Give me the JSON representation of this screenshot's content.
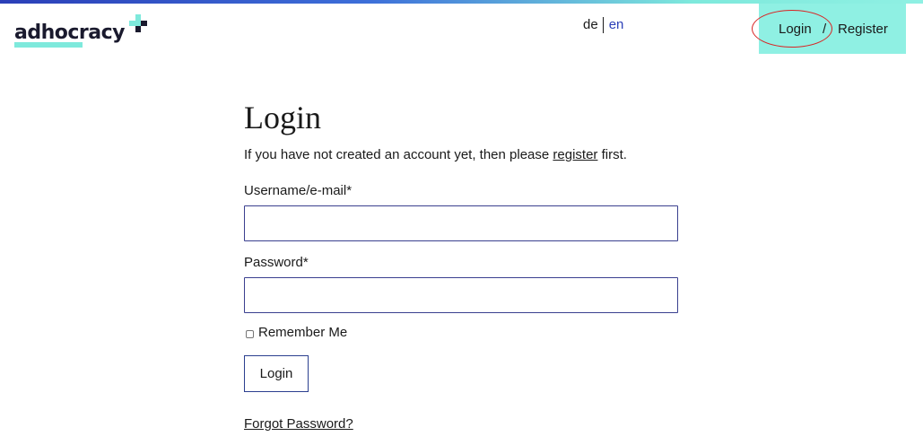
{
  "header": {
    "logo_text": "adhocracy",
    "languages": {
      "de": "de",
      "en": "en",
      "active": "en"
    },
    "auth": {
      "login_label": "Login",
      "separator": "/",
      "register_label": "Register"
    }
  },
  "main": {
    "title": "Login",
    "intro_before": "If you have not created an account yet, then please ",
    "intro_link": "register",
    "intro_after": " first.",
    "username_label": "Username/e-mail*",
    "username_value": "",
    "password_label": "Password*",
    "password_value": "",
    "remember_label": "Remember Me",
    "remember_checked": false,
    "submit_label": "Login",
    "forgot_link": "Forgot Password?"
  },
  "colors": {
    "brand_dark": "#2b3fb8",
    "brand_mint": "#8ff0e3",
    "text": "#1a1a1a",
    "annotation": "#d92323"
  },
  "icons": {
    "logo_mark": "plus-mark-icon"
  }
}
